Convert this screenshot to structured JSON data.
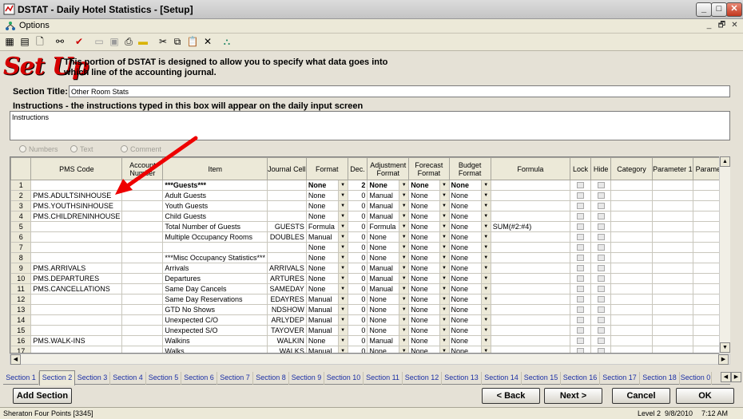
{
  "window": {
    "title": "DSTAT - Daily Hotel Statistics - [Setup]",
    "min": "_",
    "max": "□",
    "close": "✕"
  },
  "menu": {
    "options": "Options",
    "mdi_min": "_",
    "mdi_restore": "🗗",
    "mdi_close": "✕"
  },
  "toolbar": {
    "icons": [
      "grid-icon",
      "grid2-icon",
      "new-document-icon",
      "binoculars-icon",
      "checkmark-icon",
      "open-folder-icon",
      "save-icon",
      "print-icon",
      "highlight-icon",
      "cut-icon",
      "copy-icon",
      "paste-icon",
      "delete-icon",
      "tree-icon"
    ]
  },
  "header": {
    "logo": "Set Up",
    "intro": "This portion of DSTAT is designed to allow you to specify what data goes into which line of the accounting journal."
  },
  "section_title": {
    "label": "Section Title:",
    "value": "Other Room Stats"
  },
  "instructions": {
    "label": "Instructions - the instructions typed in this box will appear on the daily input screen",
    "value": "Instructions"
  },
  "radios": [
    "Numbers",
    "Text",
    "Comment"
  ],
  "grid": {
    "columns": [
      "",
      "PMS Code",
      "Account Number",
      "Item",
      "Journal Cell",
      "Format",
      "Dec.",
      "Adjustment Format",
      "Forecast Format",
      "Budget Format",
      "Formula",
      "Lock",
      "Hide",
      "Category",
      "Parameter 1",
      "Paramete"
    ],
    "rows": [
      [
        "1",
        "",
        "",
        "***Guests***",
        "",
        "None",
        "2",
        "None",
        "None",
        "None",
        ""
      ],
      [
        "2",
        "PMS.ADULTSINHOUSE",
        "",
        "Adult Guests",
        "",
        "None",
        "0",
        "Manual",
        "None",
        "None",
        ""
      ],
      [
        "3",
        "PMS.YOUTHSINHOUSE",
        "",
        "Youth Guests",
        "",
        "None",
        "0",
        "Manual",
        "None",
        "None",
        ""
      ],
      [
        "4",
        "PMS.CHILDRENINHOUSE",
        "",
        "Child Guests",
        "",
        "None",
        "0",
        "Manual",
        "None",
        "None",
        ""
      ],
      [
        "5",
        "",
        "",
        "Total Number of Guests",
        "GUESTS",
        "Formula",
        "0",
        "Formula",
        "None",
        "None",
        "SUM(#2:#4)"
      ],
      [
        "6",
        "",
        "",
        "Multiple Occupancy Rooms",
        "DOUBLES",
        "Manual",
        "0",
        "None",
        "None",
        "None",
        ""
      ],
      [
        "7",
        "",
        "",
        "",
        "",
        "None",
        "0",
        "None",
        "None",
        "None",
        ""
      ],
      [
        "8",
        "",
        "",
        "***Misc Occupancy Statistics***",
        "",
        "None",
        "0",
        "None",
        "None",
        "None",
        ""
      ],
      [
        "9",
        "PMS.ARRIVALS",
        "",
        "Arrivals",
        "ARRIVALS",
        "None",
        "0",
        "Manual",
        "None",
        "None",
        ""
      ],
      [
        "10",
        "PMS.DEPARTURES",
        "",
        "Departures",
        "ARTURES",
        "None",
        "0",
        "Manual",
        "None",
        "None",
        ""
      ],
      [
        "11",
        "PMS.CANCELLATIONS",
        "",
        "Same Day Cancels",
        "SAMEDAY",
        "None",
        "0",
        "Manual",
        "None",
        "None",
        ""
      ],
      [
        "12",
        "",
        "",
        "Same Day Reservations",
        "EDAYRES",
        "Manual",
        "0",
        "None",
        "None",
        "None",
        ""
      ],
      [
        "13",
        "",
        "",
        "GTD No Shows",
        "NDSHOW",
        "Manual",
        "0",
        "None",
        "None",
        "None",
        ""
      ],
      [
        "14",
        "",
        "",
        "Unexpected C/O",
        "ARLYDEP",
        "Manual",
        "0",
        "None",
        "None",
        "None",
        ""
      ],
      [
        "15",
        "",
        "",
        "Unexpected S/O",
        "TAYOVER",
        "Manual",
        "0",
        "None",
        "None",
        "None",
        ""
      ],
      [
        "16",
        "PMS.WALK-INS",
        "",
        "Walkins",
        "WALKIN",
        "None",
        "0",
        "Manual",
        "None",
        "None",
        ""
      ],
      [
        "17",
        "",
        "",
        "Walks",
        "WALKS",
        "Manual",
        "0",
        "None",
        "None",
        "None",
        ""
      ]
    ]
  },
  "tabs": [
    "Section 1",
    "Section 2",
    "Section 3",
    "Section 4",
    "Section 5",
    "Section 6",
    "Section 7",
    "Section 8",
    "Section 9",
    "Section 10",
    "Section 11",
    "Section 12",
    "Section 13",
    "Section 14",
    "Section 15",
    "Section 16",
    "Section 17",
    "Section 18",
    "Section 0"
  ],
  "buttons": {
    "add_section": "Add Section",
    "back": "< Back",
    "next": "Next >",
    "cancel": "Cancel",
    "ok": "OK"
  },
  "status": {
    "property": "Sheraton Four Points [3345]",
    "level": "Level 2",
    "date": "9/8/2010",
    "time": "7:12 AM"
  }
}
